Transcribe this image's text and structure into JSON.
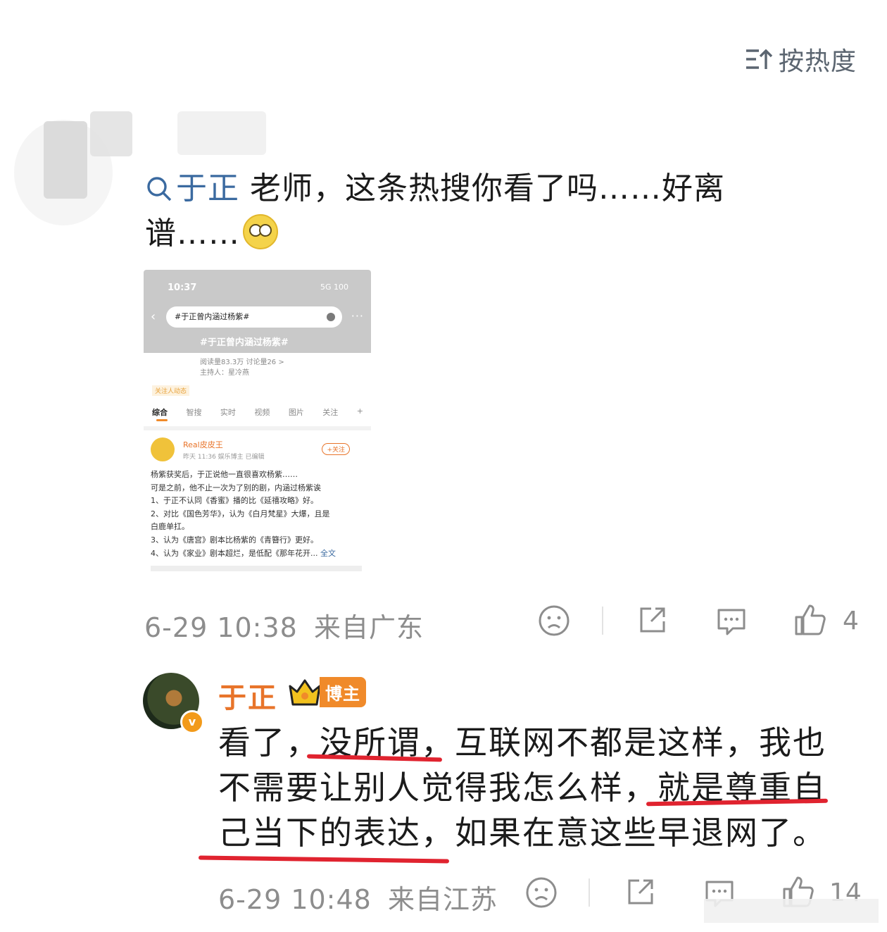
{
  "sort": {
    "label": "按热度"
  },
  "comment1": {
    "mention": "于正",
    "text": " 老师，这条热搜你看了吗……好离谱……",
    "timestamp": "6-29 10:38",
    "location": "来自广东",
    "like_count": "4"
  },
  "screenshot": {
    "time": "10:37",
    "signal": "5G 100",
    "search_query": "#于正曾内涵过杨紫#",
    "topic_title": "#于正曾内涵过杨紫#",
    "stats_line1": "阅读量83.3万  讨论量26  >",
    "stats_line2": "主持人：星冷燕",
    "follow_label": "关注人动态",
    "tabs": [
      "综合",
      "智搜",
      "实时",
      "视频",
      "图片",
      "关注",
      "+"
    ],
    "post_user": "Real皮皮王",
    "post_meta": "昨天 11:36  娱乐博主  已编辑",
    "follow_button": "+关注",
    "post_lines": [
      "杨紫获奖后，于正说他一直很喜欢杨紫……",
      "可是之前，他不止一次为了别的剧，内涵过杨紫诶",
      "1、于正不认同《香蜜》播的比《延禧攻略》好。",
      "2、对比《国色芳华》，认为《白月梵星》大爆，且是",
      "白鹿单扛。",
      "3、认为《唐宫》剧本比杨紫的《青簪行》更好。",
      "4、认为《家业》剧本超烂，是低配《那年花开..."
    ],
    "full_text_link": "全文"
  },
  "reply": {
    "name": "于正",
    "badge": "博主",
    "text": "看了，没所谓，互联网不都是这样，我也不需要让别人觉得我怎么样，就是尊重自己当下的表达，如果在意这些早退网了。",
    "timestamp": "6-29 10:48",
    "location": "来自江苏",
    "like_count": "14"
  },
  "colors": {
    "accent": "#e8742a",
    "link": "#3b6aa0",
    "underline": "#e0232f",
    "meta": "#8d8d8d"
  }
}
